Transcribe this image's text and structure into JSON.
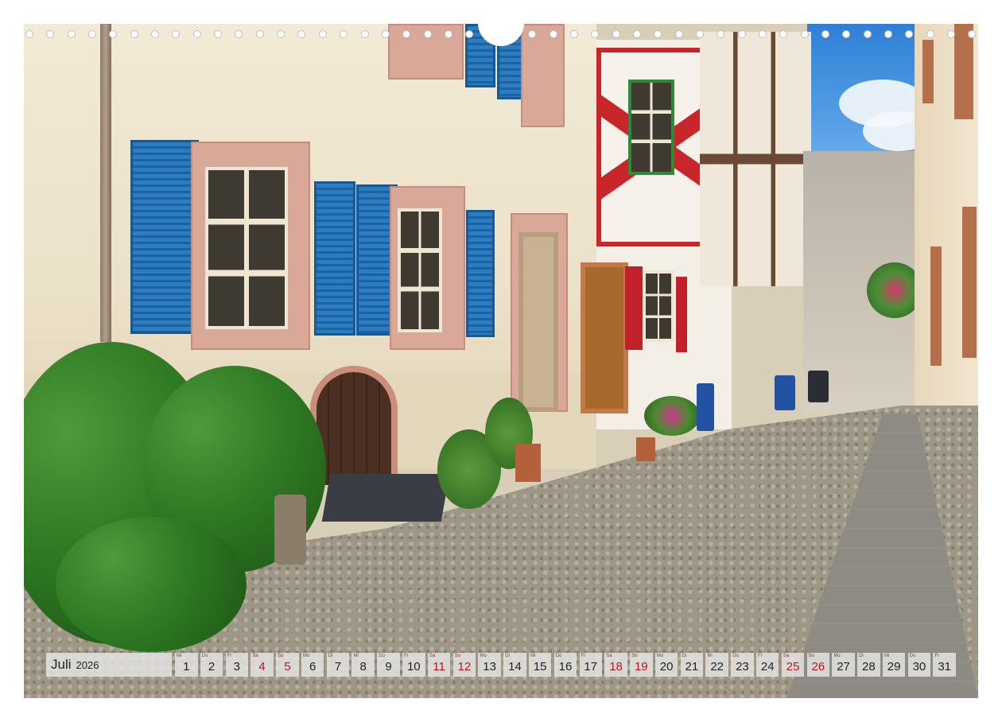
{
  "calendar": {
    "month": "Juli",
    "year": "2026",
    "accent_weekend": "#c0141c",
    "days": [
      {
        "dow": "Mi",
        "num": "1",
        "weekend": false
      },
      {
        "dow": "Do",
        "num": "2",
        "weekend": false
      },
      {
        "dow": "Fr",
        "num": "3",
        "weekend": false
      },
      {
        "dow": "Sa",
        "num": "4",
        "weekend": true
      },
      {
        "dow": "So",
        "num": "5",
        "weekend": true
      },
      {
        "dow": "Mo",
        "num": "6",
        "weekend": false
      },
      {
        "dow": "Di",
        "num": "7",
        "weekend": false
      },
      {
        "dow": "Mi",
        "num": "8",
        "weekend": false
      },
      {
        "dow": "Do",
        "num": "9",
        "weekend": false
      },
      {
        "dow": "Fr",
        "num": "10",
        "weekend": false
      },
      {
        "dow": "Sa",
        "num": "11",
        "weekend": true
      },
      {
        "dow": "So",
        "num": "12",
        "weekend": true
      },
      {
        "dow": "Mo",
        "num": "13",
        "weekend": false
      },
      {
        "dow": "Di",
        "num": "14",
        "weekend": false
      },
      {
        "dow": "Mi",
        "num": "15",
        "weekend": false
      },
      {
        "dow": "Do",
        "num": "16",
        "weekend": false
      },
      {
        "dow": "Fr",
        "num": "17",
        "weekend": false
      },
      {
        "dow": "Sa",
        "num": "18",
        "weekend": true
      },
      {
        "dow": "So",
        "num": "19",
        "weekend": true
      },
      {
        "dow": "Mo",
        "num": "20",
        "weekend": false
      },
      {
        "dow": "Di",
        "num": "21",
        "weekend": false
      },
      {
        "dow": "Mi",
        "num": "22",
        "weekend": false
      },
      {
        "dow": "Do",
        "num": "23",
        "weekend": false
      },
      {
        "dow": "Fr",
        "num": "24",
        "weekend": false
      },
      {
        "dow": "Sa",
        "num": "25",
        "weekend": true
      },
      {
        "dow": "So",
        "num": "26",
        "weekend": true
      },
      {
        "dow": "Mo",
        "num": "27",
        "weekend": false
      },
      {
        "dow": "Di",
        "num": "28",
        "weekend": false
      },
      {
        "dow": "Mi",
        "num": "29",
        "weekend": false
      },
      {
        "dow": "Do",
        "num": "30",
        "weekend": false
      },
      {
        "dow": "Fr",
        "num": "31",
        "weekend": false
      }
    ]
  },
  "binding": {
    "ring_count": 46,
    "icon": "wire-binding-hole-icon"
  }
}
